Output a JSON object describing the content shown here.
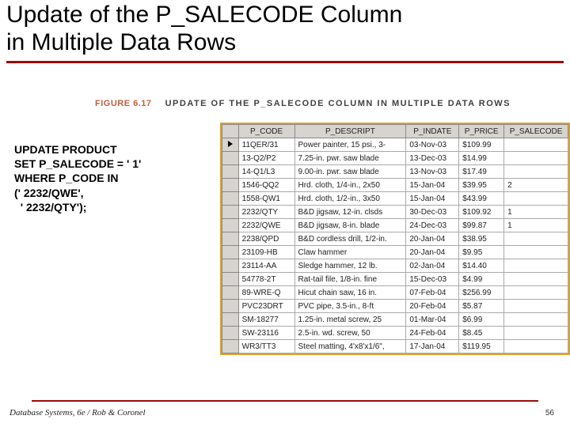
{
  "title_line1": "Update of the P_SALECODE Column",
  "title_line2": "in Multiple Data Rows",
  "figure": {
    "number": "FIGURE 6.17",
    "title": "UPDATE OF THE P_SALECODE COLUMN IN MULTIPLE DATA ROWS"
  },
  "sql": "UPDATE PRODUCT\nSET P_SALECODE = ' 1'\nWHERE P_CODE IN\n(' 2232/QWE',\n  ' 2232/QTY');",
  "table": {
    "columns": [
      "P_CODE",
      "P_DESCRIPT",
      "P_INDATE",
      "P_PRICE",
      "P_SALECODE"
    ],
    "rows": [
      {
        "code": "11QER/31",
        "desc": "Power painter, 15 psi., 3-",
        "date": "03-Nov-03",
        "price": "$109.99",
        "sale": ""
      },
      {
        "code": "13-Q2/P2",
        "desc": "7.25-in. pwr. saw blade",
        "date": "13-Dec-03",
        "price": "$14.99",
        "sale": ""
      },
      {
        "code": "14-Q1/L3",
        "desc": "9.00-in. pwr. saw blade",
        "date": "13-Nov-03",
        "price": "$17.49",
        "sale": ""
      },
      {
        "code": "1546-QQ2",
        "desc": "Hrd. cloth, 1/4-in., 2x50",
        "date": "15-Jan-04",
        "price": "$39.95",
        "sale": "2"
      },
      {
        "code": "1558-QW1",
        "desc": "Hrd. cloth, 1/2-in., 3x50",
        "date": "15-Jan-04",
        "price": "$43.99",
        "sale": ""
      },
      {
        "code": "2232/QTY",
        "desc": "B&D jigsaw, 12-in. clsds",
        "date": "30-Dec-03",
        "price": "$109.92",
        "sale": "1"
      },
      {
        "code": "2232/QWE",
        "desc": "B&D jigsaw, 8-in. blade",
        "date": "24-Dec-03",
        "price": "$99.87",
        "sale": "1"
      },
      {
        "code": "2238/QPD",
        "desc": "B&D cordless drill, 1/2-in.",
        "date": "20-Jan-04",
        "price": "$38.95",
        "sale": ""
      },
      {
        "code": "23109-HB",
        "desc": "Claw hammer",
        "date": "20-Jan-04",
        "price": "$9.95",
        "sale": ""
      },
      {
        "code": "23114-AA",
        "desc": "Sledge hammer, 12 lb.",
        "date": "02-Jan-04",
        "price": "$14.40",
        "sale": ""
      },
      {
        "code": "54778-2T",
        "desc": "Rat-tail file, 1/8-in. fine",
        "date": "15-Dec-03",
        "price": "$4.99",
        "sale": ""
      },
      {
        "code": "89-WRE-Q",
        "desc": "Hicut chain saw, 16 in.",
        "date": "07-Feb-04",
        "price": "$256.99",
        "sale": ""
      },
      {
        "code": "PVC23DRT",
        "desc": "PVC pipe, 3.5-in., 8-ft",
        "date": "20-Feb-04",
        "price": "$5.87",
        "sale": ""
      },
      {
        "code": "SM-18277",
        "desc": "1.25-in. metal screw, 25",
        "date": "01-Mar-04",
        "price": "$6.99",
        "sale": ""
      },
      {
        "code": "SW-23116",
        "desc": "2.5-in. wd. screw, 50",
        "date": "24-Feb-04",
        "price": "$8.45",
        "sale": ""
      },
      {
        "code": "WR3/TT3",
        "desc": "Steel matting, 4'x8'x1/6\",",
        "date": "17-Jan-04",
        "price": "$119.95",
        "sale": ""
      }
    ]
  },
  "footer": {
    "left": "Database Systems, 6e / Rob & Coronel",
    "pageno": "56"
  }
}
